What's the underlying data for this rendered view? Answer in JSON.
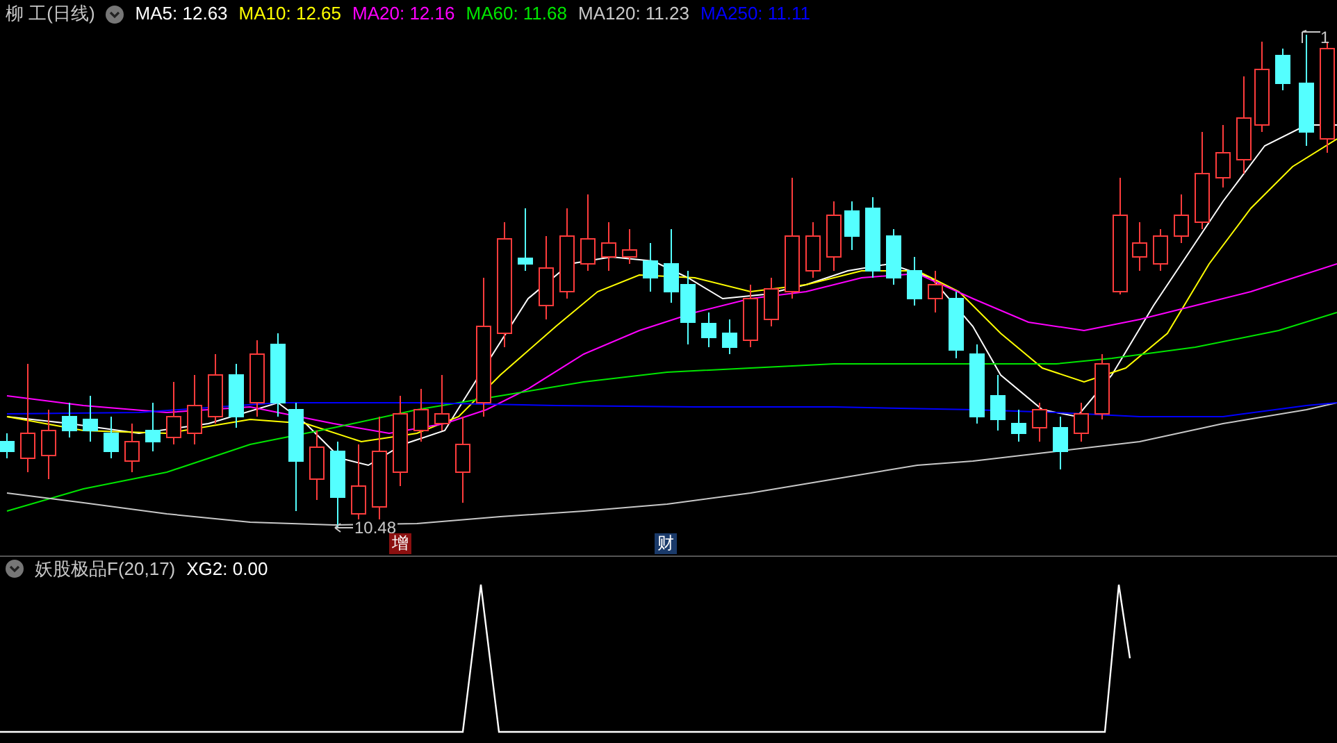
{
  "header": {
    "name": "柳 工",
    "period": "(日线)"
  },
  "moving_averages": [
    {
      "label": "MA5: 12.63",
      "color": "#ffffff"
    },
    {
      "label": "MA10: 12.65",
      "color": "#ffff00"
    },
    {
      "label": "MA20: 12.16",
      "color": "#ff00ff"
    },
    {
      "label": "MA60: 11.68",
      "color": "#00e600"
    },
    {
      "label": "MA120: 11.23",
      "color": "#c8c8c8"
    },
    {
      "label": "MA250: 11.11",
      "color": "#0000ff"
    }
  ],
  "price_chart": {
    "low_label": "10.48",
    "high_label": "1",
    "markers": [
      {
        "text": "增",
        "color": "#8b1010"
      },
      {
        "text": "财",
        "color": "#1a3a6a"
      }
    ]
  },
  "indicator_panel": {
    "name": "妖股极品F(20,17)",
    "reading": "XG2: 0.00"
  }
}
